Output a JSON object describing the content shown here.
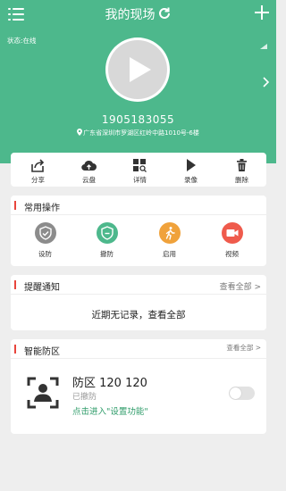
{
  "header": {
    "title": "我的现场",
    "status": "状态:在线"
  },
  "device": {
    "phone": "1905183055",
    "address": "广东省深圳市罗湖区红岭中路1010号-6楼"
  },
  "toolbar": [
    {
      "label": "分享",
      "icon": "share-icon"
    },
    {
      "label": "云盘",
      "icon": "cloud-upload-icon"
    },
    {
      "label": "详情",
      "icon": "details-grid-icon"
    },
    {
      "label": "录像",
      "icon": "record-play-icon"
    },
    {
      "label": "删除",
      "icon": "trash-icon"
    }
  ],
  "common_ops": {
    "title": "常用操作",
    "items": [
      {
        "label": "设防",
        "icon": "shield-arm-icon",
        "color": "#8c8c8c"
      },
      {
        "label": "撤防",
        "icon": "shield-disarm-icon",
        "color": "#4db88c"
      },
      {
        "label": "启用",
        "icon": "walk-icon",
        "color": "#f0a23b"
      },
      {
        "label": "视频",
        "icon": "video-camera-icon",
        "color": "#ef5b4c"
      }
    ]
  },
  "notice": {
    "title": "提醒通知",
    "more": "查看全部 >",
    "empty_text": "近期无记录，查看全部"
  },
  "zone": {
    "title": "智能防区",
    "more": "查看全部 >",
    "name": "防区 120 120",
    "status": "已撤防",
    "link": "点击进入\"设置功能\"",
    "toggle_on": false
  },
  "colors": {
    "brand": "#4db88c",
    "accent_red": "#e8453c",
    "link_green": "#2f9c6a"
  }
}
